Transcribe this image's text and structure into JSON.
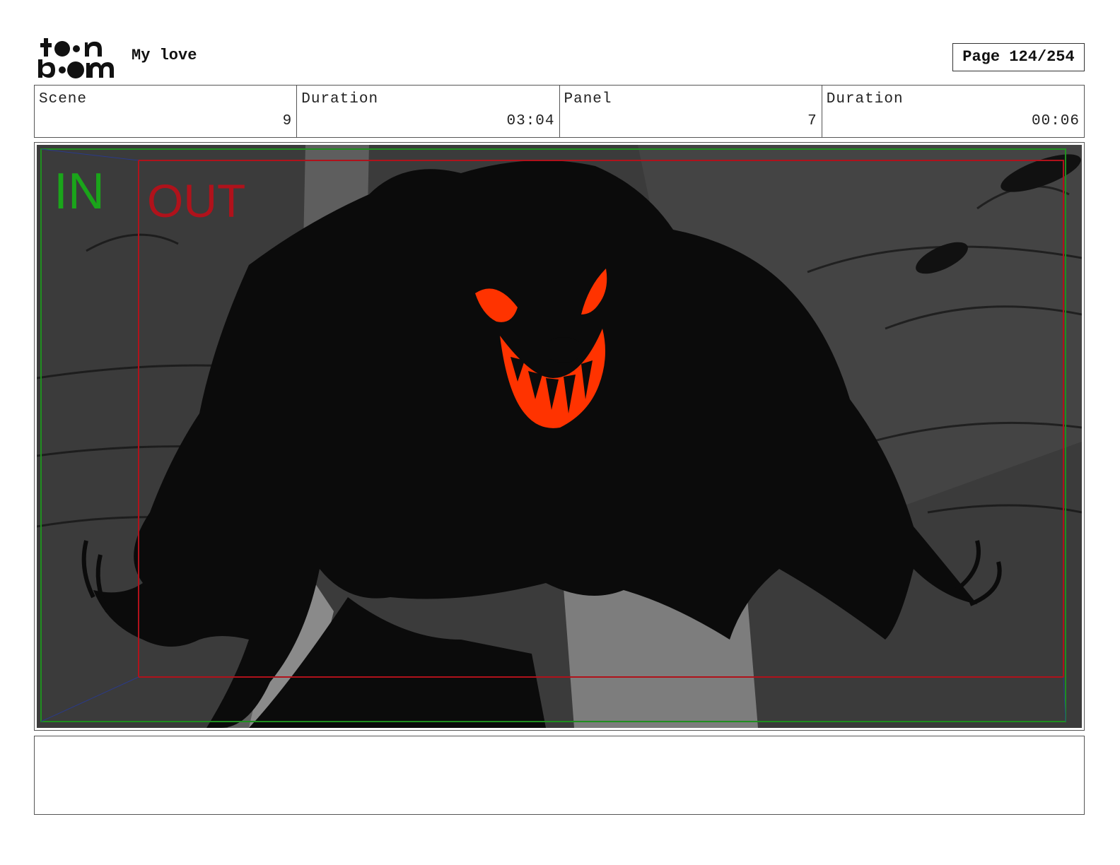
{
  "header": {
    "logo_top": "toon",
    "logo_bottom": "boom",
    "project_title": "My love",
    "page_label": "Page 124/254"
  },
  "info": {
    "scene_label": "Scene",
    "scene_value": "9",
    "scene_duration_label": "Duration",
    "scene_duration_value": "03:04",
    "panel_label": "Panel",
    "panel_value": "7",
    "panel_duration_label": "Duration",
    "panel_duration_value": "00:06"
  },
  "panel_image": {
    "in_label": "IN",
    "out_label": "OUT",
    "in_color": "#1aa51a",
    "out_color": "#b0121b",
    "eye_color": "#ff3300"
  },
  "notes": {
    "text": ""
  }
}
